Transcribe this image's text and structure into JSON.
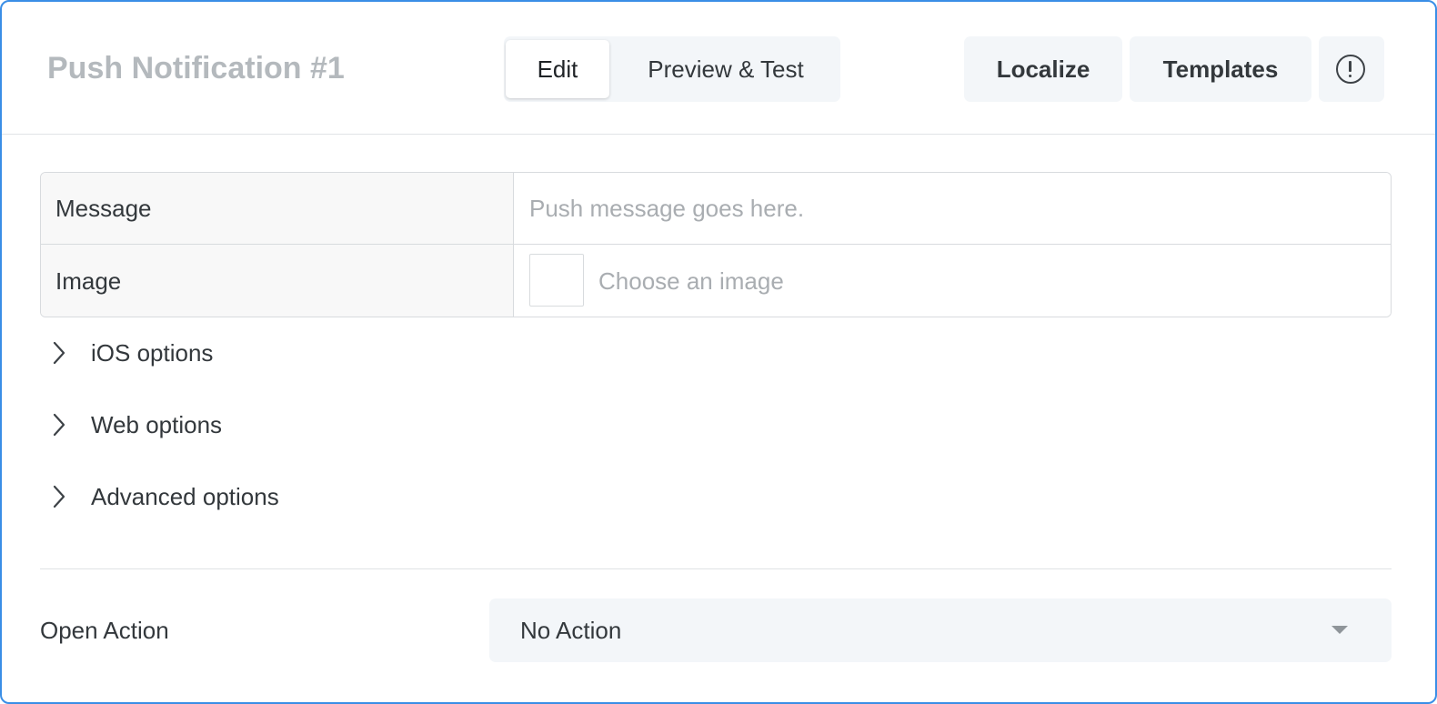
{
  "header": {
    "title": "Push Notification #1",
    "tabs": [
      {
        "label": "Edit",
        "active": true
      },
      {
        "label": "Preview & Test",
        "active": false
      }
    ],
    "localize_label": "Localize",
    "templates_label": "Templates",
    "info_icon": "exclamation-circle-icon"
  },
  "form": {
    "message_label": "Message",
    "message_placeholder": "Push message goes here.",
    "image_label": "Image",
    "image_placeholder": "Choose an image"
  },
  "options": [
    {
      "label": "iOS options",
      "icon": "chevron-right-icon"
    },
    {
      "label": "Web options",
      "icon": "chevron-right-icon"
    },
    {
      "label": "Advanced options",
      "icon": "chevron-right-icon"
    }
  ],
  "open_action": {
    "label": "Open Action",
    "value": "No Action",
    "icon": "caret-down-icon"
  },
  "colors": {
    "frame_border": "#3a8ee6",
    "button_bg": "#f3f6f9",
    "title_muted": "#b4b9bd",
    "label_bg": "#f8f8f8"
  }
}
